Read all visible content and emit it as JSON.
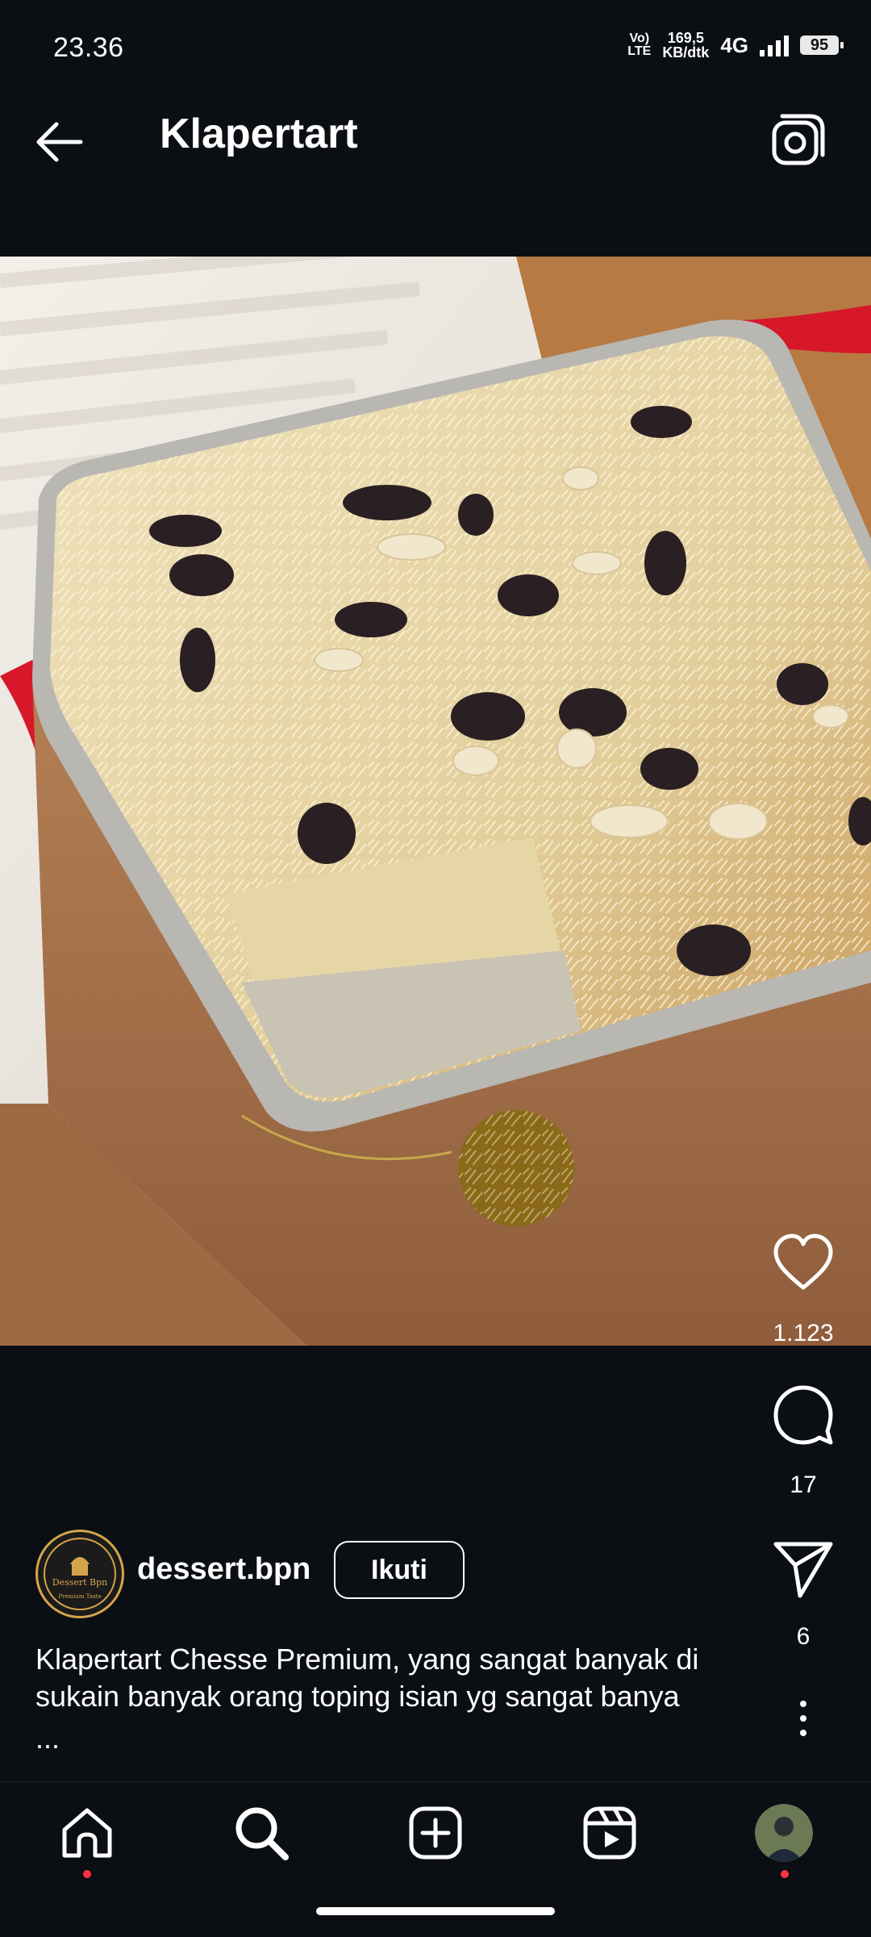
{
  "status_bar": {
    "time": "23.36",
    "volte": "VoLTE",
    "net_speed_top": "169,5",
    "net_speed_bottom": "KB/dtk",
    "network": "4G",
    "battery": "95"
  },
  "header": {
    "title": "Klapertart",
    "back_icon": "arrow-left-icon",
    "camera_icon": "camera-icon"
  },
  "post": {
    "image_alt": "Klapertart cheese dessert in foil tray",
    "likes": "1.123",
    "comments": "17",
    "shares": "6",
    "author": {
      "username": "dessert.bpn",
      "avatar_text_top": "Dessert Bpn",
      "avatar_text_bottom": "Premium Taste",
      "follow_label": "Ikuti"
    },
    "caption_line1": "Klapertart Chesse Premium, yang sangat banyak di",
    "caption_line2": "sukain banyak orang toping isian yg sangat banya",
    "caption_more": "..."
  },
  "nav": {
    "items": [
      "home-icon",
      "search-icon",
      "create-icon",
      "reels-icon",
      "profile-avatar"
    ]
  },
  "colors": {
    "background": "#0b0f14",
    "accent_dot": "#ff3040",
    "text": "#ffffff"
  }
}
